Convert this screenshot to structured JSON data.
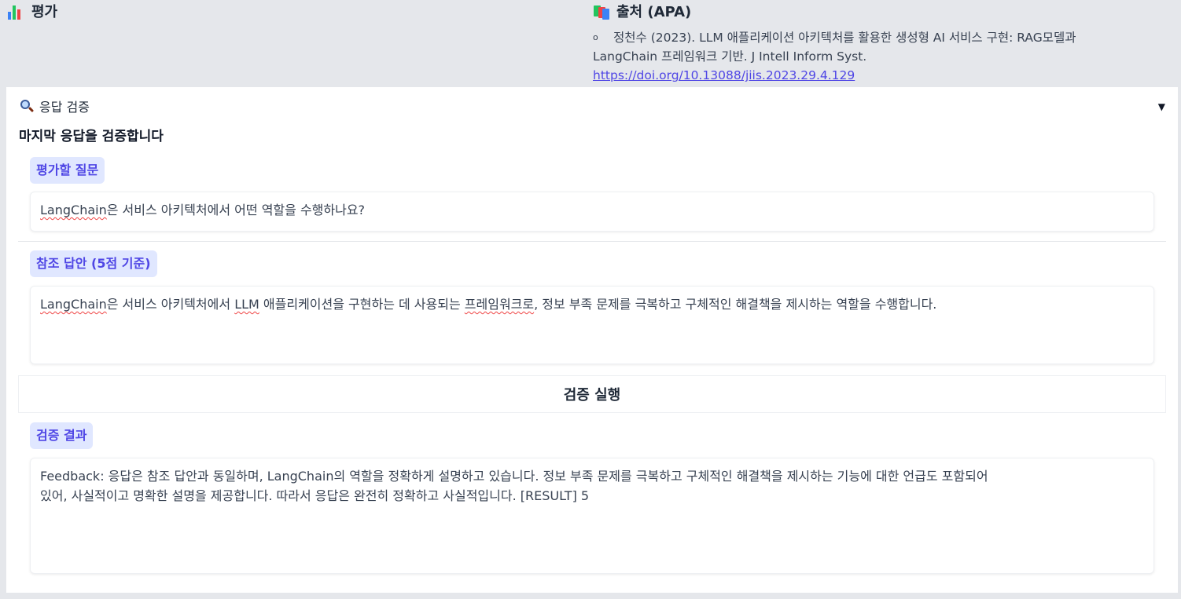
{
  "top": {
    "evaluation": {
      "heading": "평가",
      "icon": "bar-chart-icon"
    },
    "source": {
      "heading": "출처 (APA)",
      "icon": "books-icon",
      "bullet": "o",
      "citation_line1": "정천수 (2023). LLM 애플리케이션 아키텍처를 활용한 생성형 AI 서비스 구현: RAG모델과",
      "citation_line2": "LangChain 프레임워크 기반. J Intell Inform Syst.",
      "doi": "https://doi.org/10.13088/jiis.2023.29.4.129"
    }
  },
  "panel": {
    "header": "응답 검증",
    "header_icon": "magnifier-icon",
    "caret": "▼",
    "title": "마지막 응답을 검증합니다",
    "question": {
      "label": "평가할 질문",
      "word": "LangChain",
      "rest": "은 서비스 아키텍처에서 어떤 역할을 수행하나요?"
    },
    "reference": {
      "label": "참조 답안 (5점 기준)",
      "word1": "LangChain",
      "part1": "은 서비스 아키텍처에서 ",
      "word2": "LLM",
      "part2": " 애플리케이션을 구현하는 데 사용되는 ",
      "word3": "프레임워크로",
      "part3": ", 정보 부족 문제를 극복하고 구체적인 해결책을 제시하는 역할을 수행합니다."
    },
    "run_button": "검증 실행",
    "result": {
      "label": "검증 결과",
      "line1": "Feedback: 응답은 참조 답안과 동일하며, LangChain의 역할을 정확하게 설명하고 있습니다. 정보 부족 문제를 극복하고 구체적인 해결책을 제시하는 기능에 대한 언급도 포함되어",
      "line2": "있어, 사실적이고 명확한 설명을 제공합니다. 따라서 응답은 완전히 정확하고 사실적입니다. [RESULT] 5"
    }
  },
  "colors": {
    "accent": "#4f46e5",
    "chip_bg": "#e0e7ff",
    "page_bg": "#e5e7eb"
  }
}
